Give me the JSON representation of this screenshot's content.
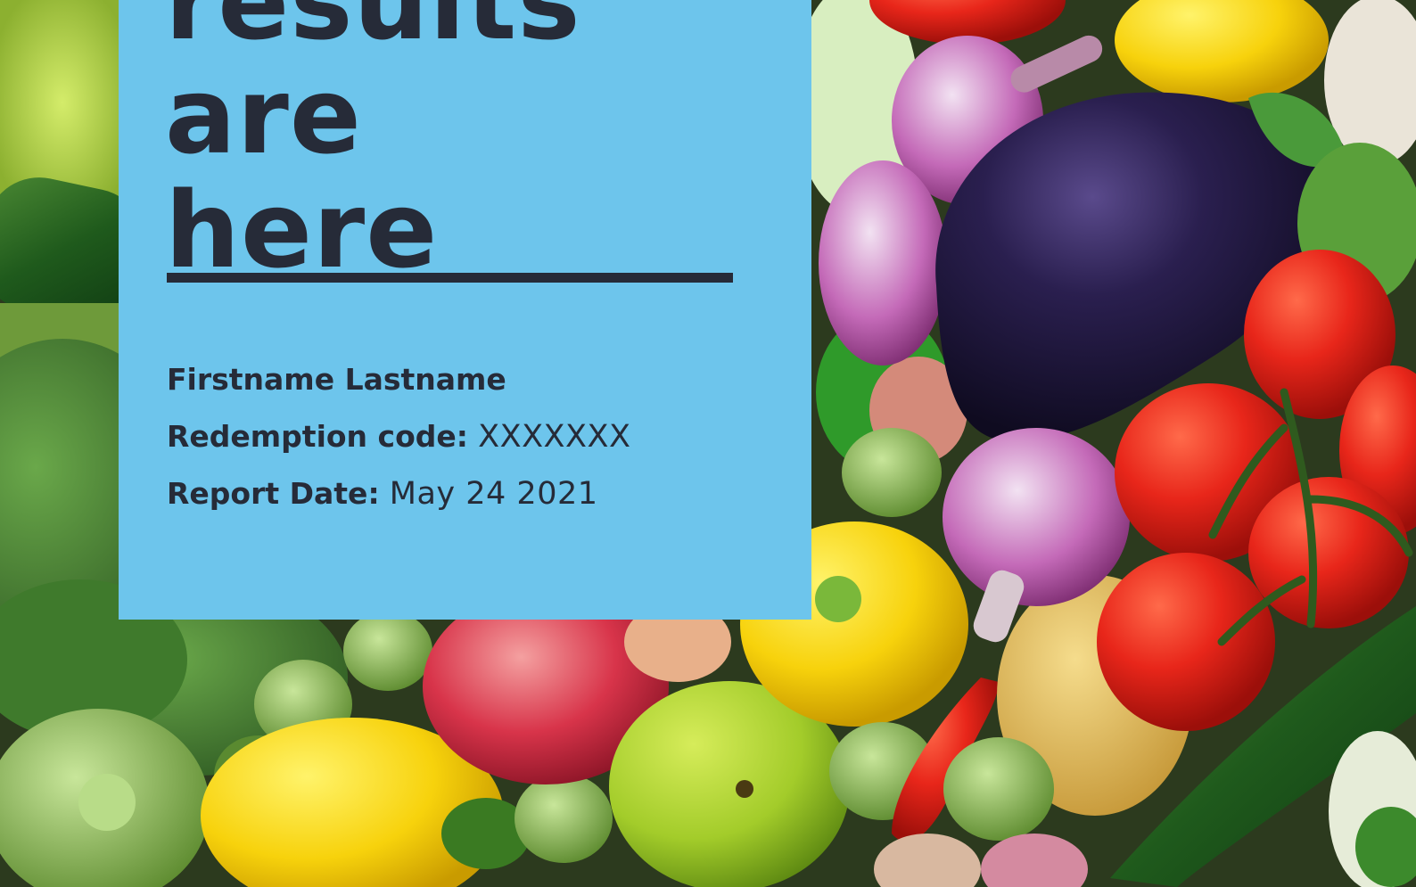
{
  "headline": {
    "line1": "results are",
    "line2": "here"
  },
  "recipient": {
    "name": "Firstname Lastname",
    "redemption_label": "Redemption code:",
    "redemption_value": "XXXXXXX",
    "date_label": "Report Date:",
    "date_value": "May 24 2021"
  },
  "colors": {
    "panel": "#6dc5ec",
    "text": "#262b38"
  }
}
